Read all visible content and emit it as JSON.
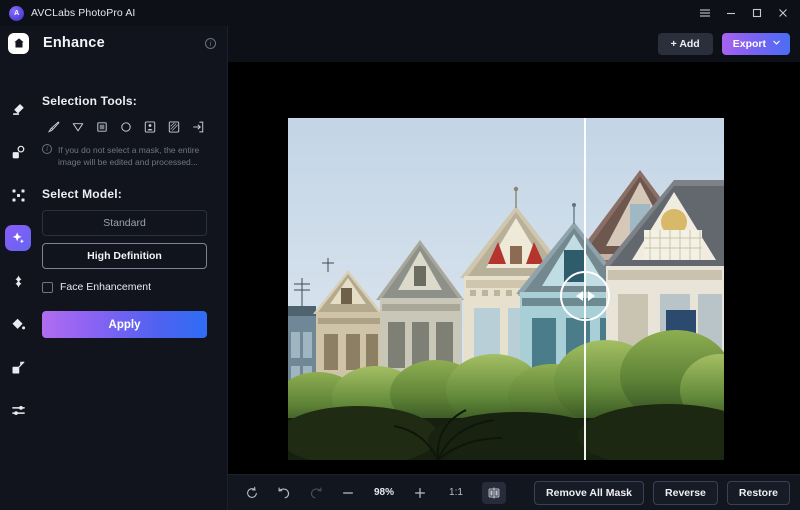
{
  "titlebar": {
    "app_name": "AVCLabs PhotoPro AI",
    "logo_text": "A",
    "controls": [
      {
        "name": "menu-button",
        "icon": "hamburger-icon"
      },
      {
        "name": "minimize-button",
        "icon": "minimize-icon"
      },
      {
        "name": "maximize-button",
        "icon": "maximize-icon"
      },
      {
        "name": "close-button",
        "icon": "close-icon"
      }
    ]
  },
  "sidebar": {
    "header": {
      "home_icon": "home-icon",
      "title": "Enhance",
      "info_icon": "info-icon",
      "info_char": "i"
    },
    "rail": [
      {
        "name": "rail-item-eraser",
        "icon": "eraser-icon",
        "active": false
      },
      {
        "name": "rail-item-remove-object",
        "icon": "object-remove-icon",
        "active": false
      },
      {
        "name": "rail-item-background",
        "icon": "background-icon",
        "active": false
      },
      {
        "name": "rail-item-enhance",
        "icon": "enhance-sparkle-icon",
        "active": true
      },
      {
        "name": "rail-item-retouch",
        "icon": "retouch-icon",
        "active": false
      },
      {
        "name": "rail-item-colorize",
        "icon": "color-drop-icon",
        "active": false
      },
      {
        "name": "rail-item-resize",
        "icon": "resize-icon",
        "active": false
      },
      {
        "name": "rail-item-adjust",
        "icon": "sliders-icon",
        "active": false
      }
    ],
    "selection_tools": {
      "label": "Selection Tools:",
      "tools": [
        {
          "name": "tool-brush",
          "icon": "brush-icon"
        },
        {
          "name": "tool-lasso",
          "icon": "lasso-pointer-icon"
        },
        {
          "name": "tool-rectangle",
          "icon": "rectangle-icon"
        },
        {
          "name": "tool-ellipse",
          "icon": "ellipse-icon"
        },
        {
          "name": "tool-select-subject",
          "icon": "person-box-icon"
        },
        {
          "name": "tool-select-sky",
          "icon": "sky-box-icon"
        },
        {
          "name": "tool-import-mask",
          "icon": "arrow-in-box-icon"
        }
      ],
      "hint": "If you do not select a mask, the entire image will be edited and processed...",
      "hint_icon": "info-icon"
    },
    "select_model": {
      "label": "Select Model:",
      "options": [
        {
          "name": "model-standard",
          "label": "Standard",
          "selected": false
        },
        {
          "name": "model-high-definition",
          "label": "High Definition",
          "selected": true
        }
      ]
    },
    "face_enhancement": {
      "label": "Face Enhancement",
      "checked": false
    },
    "apply_label": "Apply"
  },
  "main": {
    "header": {
      "add_label": "+ Add",
      "add_icon": "plus-icon",
      "export_label": "Export",
      "export_caret_icon": "chevron-down-icon"
    },
    "canvas": {
      "image_alt": "Painted Ladies Victorian houses row, San Francisco",
      "compare_handle_icon": "left-right-arrows-icon",
      "split_position_percent": 68
    },
    "bottombar": {
      "zoom_tools": [
        {
          "name": "reset-button",
          "icon": "reset-circle-icon",
          "type": "icon",
          "disabled": false
        },
        {
          "name": "undo-button",
          "icon": "undo-icon",
          "type": "icon",
          "disabled": false
        },
        {
          "name": "redo-button",
          "icon": "redo-icon",
          "type": "icon",
          "disabled": true
        },
        {
          "name": "zoom-out-button",
          "icon": "minus-icon",
          "type": "icon",
          "disabled": false
        },
        {
          "name": "zoom-level",
          "label": "98%",
          "type": "text",
          "disabled": false
        },
        {
          "name": "zoom-in-button",
          "icon": "plus-icon",
          "type": "icon",
          "disabled": false
        },
        {
          "name": "actual-size-button",
          "label": "1:1",
          "type": "text-dim",
          "disabled": false
        },
        {
          "name": "compare-view-button",
          "icon": "split-compare-icon",
          "type": "icon-boxed",
          "disabled": false
        }
      ],
      "mask_actions": [
        {
          "name": "remove-all-mask-button",
          "label": "Remove All Mask"
        },
        {
          "name": "reverse-button",
          "label": "Reverse"
        },
        {
          "name": "restore-button",
          "label": "Restore"
        }
      ]
    }
  },
  "colors": {
    "accent_purple": "#8b5cf6",
    "accent_blue": "#4a6ef4",
    "sidebar_bg": "#11141c",
    "canvas_bg": "#000000",
    "app_bg": "#0d1016"
  }
}
